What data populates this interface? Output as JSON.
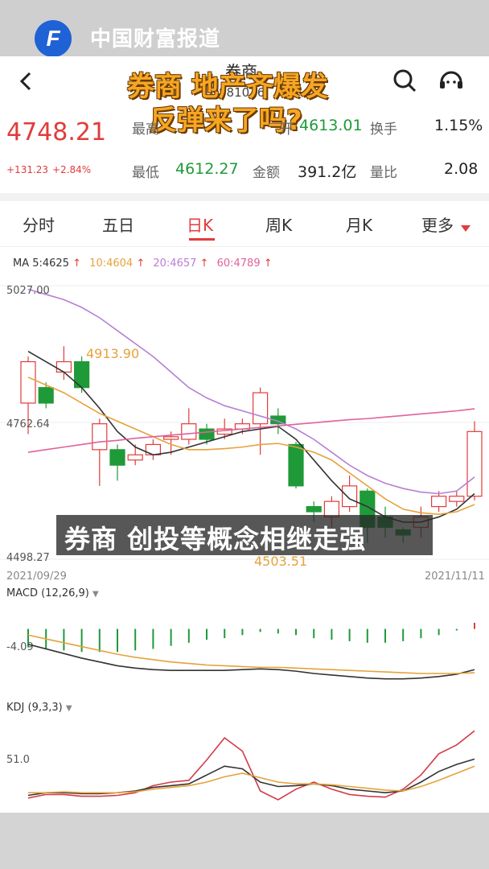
{
  "watermark": {
    "logo_text": "中国财富报道",
    "logo_letter": "F"
  },
  "header": {
    "title": "券商",
    "code": "881036"
  },
  "headline": {
    "line1": "券商 地产齐爆发",
    "line2": "反弹来了吗?"
  },
  "quote": {
    "price": "4748.21",
    "change": "+131.23",
    "change_pct": "+2.84%",
    "high_label": "最高",
    "open_label": "开",
    "open_value": "4613.01",
    "turnover_label": "换手",
    "turnover_value": "1.15%",
    "low_label": "最低",
    "low_value": "4612.27",
    "amount_label": "金额",
    "amount_value": "391.2亿",
    "ratio_label": "量比",
    "ratio_value": "2.08"
  },
  "tabs": [
    "分时",
    "五日",
    "日K",
    "周K",
    "月K",
    "更多"
  ],
  "ma_legend": {
    "ma5": "MA 5:4625",
    "ma10": "10:4604",
    "ma20": "20:4657",
    "ma60": "60:4789",
    "arrow": "↑"
  },
  "price_axis": {
    "top": "5027.00",
    "mid": "4762.64",
    "bottom": "4498.27",
    "marked_high": "4913.90",
    "marked_low": "4503.51",
    "start_date": "2021/09/29",
    "end_date": "2021/11/11"
  },
  "macd": {
    "label": "MACD (12,26,9)",
    "axis": "-4.09"
  },
  "kdj": {
    "label": "KDJ (9,3,3)",
    "axis": "51.0"
  },
  "subtitle": "券商 创投等概念相继走强",
  "colors": {
    "up": "#e23b3b",
    "down": "#1f9a38",
    "accent": "#e23b3b",
    "headline": "#f5a623"
  },
  "chart_data": {
    "type": "candlestick",
    "candles": [
      {
        "o": 4800,
        "c": 4880,
        "h": 4890,
        "l": 4740
      },
      {
        "o": 4830,
        "c": 4800,
        "h": 4840,
        "l": 4790
      },
      {
        "o": 4860,
        "c": 4880,
        "h": 4910,
        "l": 4845
      },
      {
        "o": 4880,
        "c": 4830,
        "h": 4890,
        "l": 4820
      },
      {
        "o": 4710,
        "c": 4760,
        "h": 4770,
        "l": 4640
      },
      {
        "o": 4710,
        "c": 4680,
        "h": 4720,
        "l": 4650
      },
      {
        "o": 4690,
        "c": 4700,
        "h": 4720,
        "l": 4680
      },
      {
        "o": 4700,
        "c": 4720,
        "h": 4730,
        "l": 4690
      },
      {
        "o": 4730,
        "c": 4735,
        "h": 4745,
        "l": 4700
      },
      {
        "o": 4730,
        "c": 4760,
        "h": 4790,
        "l": 4720
      },
      {
        "o": 4750,
        "c": 4730,
        "h": 4760,
        "l": 4720
      },
      {
        "o": 4740,
        "c": 4750,
        "h": 4770,
        "l": 4730
      },
      {
        "o": 4750,
        "c": 4760,
        "h": 4770,
        "l": 4740
      },
      {
        "o": 4760,
        "c": 4820,
        "h": 4830,
        "l": 4700
      },
      {
        "o": 4775,
        "c": 4760,
        "h": 4790,
        "l": 4740
      },
      {
        "o": 4720,
        "c": 4640,
        "h": 4725,
        "l": 4635
      },
      {
        "o": 4600,
        "c": 4590,
        "h": 4610,
        "l": 4570
      },
      {
        "o": 4580,
        "c": 4610,
        "h": 4620,
        "l": 4560
      },
      {
        "o": 4600,
        "c": 4640,
        "h": 4660,
        "l": 4590
      },
      {
        "o": 4630,
        "c": 4560,
        "h": 4635,
        "l": 4530
      },
      {
        "o": 4580,
        "c": 4560,
        "h": 4600,
        "l": 4540
      },
      {
        "o": 4555,
        "c": 4545,
        "h": 4560,
        "l": 4530
      },
      {
        "o": 4560,
        "c": 4580,
        "h": 4600,
        "l": 4540
      },
      {
        "o": 4600,
        "c": 4620,
        "h": 4630,
        "l": 4590
      },
      {
        "o": 4610,
        "c": 4620,
        "h": 4630,
        "l": 4600
      },
      {
        "o": 4620,
        "c": 4745,
        "h": 4765,
        "l": 4612
      }
    ],
    "ma_lines": [
      {
        "name": "MA5",
        "color": "#333333",
        "values": [
          4900,
          4880,
          4860,
          4830,
          4790,
          4745,
          4715,
          4700,
          4705,
          4715,
          4725,
          4735,
          4745,
          4750,
          4755,
          4730,
          4690,
          4650,
          4615,
          4600,
          4580,
          4570,
          4570,
          4580,
          4595,
          4625
        ]
      },
      {
        "name": "MA10",
        "color": "#e6a23c",
        "values": [
          4850,
          4835,
          4820,
          4800,
          4780,
          4765,
          4750,
          4735,
          4720,
          4710,
          4710,
          4712,
          4715,
          4720,
          4722,
          4715,
          4705,
          4690,
          4665,
          4640,
          4615,
          4595,
          4588,
          4585,
          4590,
          4604
        ]
      },
      {
        "name": "MA20",
        "color": "#b77fd6",
        "values": [
          5020,
          5010,
          5000,
          4985,
          4965,
          4940,
          4915,
          4890,
          4860,
          4830,
          4810,
          4795,
          4785,
          4775,
          4765,
          4750,
          4730,
          4705,
          4680,
          4660,
          4645,
          4635,
          4628,
          4625,
          4630,
          4657
        ]
      },
      {
        "name": "MA60",
        "color": "#e0629a",
        "values": [
          4705,
          4710,
          4715,
          4720,
          4725,
          4728,
          4732,
          4735,
          4738,
          4741,
          4744,
          4747,
          4750,
          4753,
          4756,
          4759,
          4762,
          4765,
          4768,
          4770,
          4773,
          4776,
          4779,
          4782,
          4785,
          4789
        ]
      }
    ],
    "ylim": [
      4498.27,
      5027.0
    ],
    "macd": {
      "dif": [
        -2.0,
        -2.6,
        -3.2,
        -3.8,
        -4.3,
        -4.8,
        -5.1,
        -5.3,
        -5.4,
        -5.4,
        -5.4,
        -5.4,
        -5.3,
        -5.2,
        -5.3,
        -5.5,
        -5.8,
        -6.0,
        -6.2,
        -6.4,
        -6.5,
        -6.5,
        -6.4,
        -6.2,
        -5.9,
        -5.3
      ],
      "dea": [
        -0.8,
        -1.3,
        -1.8,
        -2.3,
        -2.8,
        -3.3,
        -3.7,
        -4.0,
        -4.3,
        -4.5,
        -4.7,
        -4.8,
        -4.9,
        -5.0,
        -5.0,
        -5.1,
        -5.2,
        -5.3,
        -5.4,
        -5.5,
        -5.6,
        -5.7,
        -5.8,
        -5.8,
        -5.8,
        -5.7
      ],
      "hist": [
        -2.4,
        -2.6,
        -2.8,
        -3.0,
        -3.0,
        -3.0,
        -2.8,
        -2.6,
        -2.2,
        -1.8,
        -1.4,
        -1.2,
        -0.8,
        -0.4,
        -0.6,
        -0.8,
        -1.2,
        -1.4,
        -1.6,
        -1.8,
        -1.8,
        -1.6,
        -1.2,
        -0.8,
        -0.2,
        0.8
      ],
      "ylim": [
        -8,
        3
      ]
    },
    "kdj": {
      "k": [
        15,
        18,
        18,
        17,
        17,
        18,
        20,
        24,
        26,
        28,
        38,
        48,
        45,
        30,
        25,
        26,
        28,
        26,
        22,
        20,
        18,
        20,
        30,
        42,
        50,
        56
      ],
      "d": [
        18,
        18,
        19,
        18,
        18,
        18,
        19,
        22,
        24,
        26,
        30,
        36,
        40,
        35,
        30,
        28,
        28,
        27,
        25,
        23,
        21,
        20,
        25,
        32,
        40,
        48
      ],
      "j": [
        12,
        16,
        16,
        14,
        14,
        15,
        18,
        26,
        30,
        32,
        55,
        80,
        65,
        20,
        10,
        22,
        30,
        22,
        16,
        14,
        13,
        22,
        38,
        62,
        72,
        88
      ],
      "ylim": [
        0,
        100
      ]
    }
  }
}
